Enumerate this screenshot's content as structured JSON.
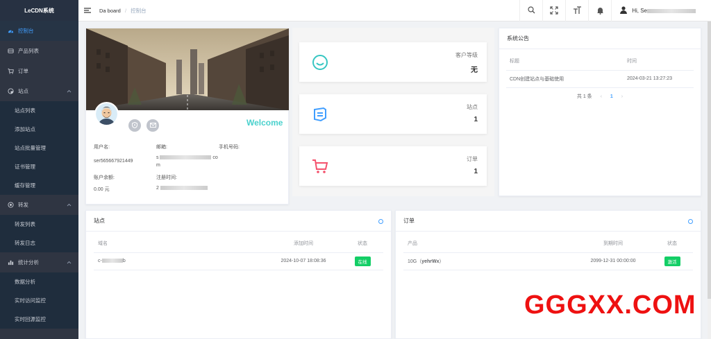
{
  "sidebar": {
    "logo": "LeCDN系统",
    "items": [
      {
        "label": "控制台",
        "icon": "dashboard-icon",
        "active": true
      },
      {
        "label": "产品列表",
        "icon": "product-icon"
      },
      {
        "label": "订单",
        "icon": "cart-icon"
      },
      {
        "label": "站点",
        "icon": "site-icon",
        "expanded": true
      },
      {
        "label": "站点列表"
      },
      {
        "label": "添加站点"
      },
      {
        "label": "站点批量管理"
      },
      {
        "label": "证书管理"
      },
      {
        "label": "缓存管理"
      },
      {
        "label": "转发",
        "icon": "forward-icon",
        "expanded": true
      },
      {
        "label": "转发列表"
      },
      {
        "label": "转发日志"
      },
      {
        "label": "统计分析",
        "icon": "stats-icon",
        "expanded": true
      },
      {
        "label": "数据分析"
      },
      {
        "label": "实时访问监控"
      },
      {
        "label": "实时回源监控"
      }
    ]
  },
  "header": {
    "breadcrumb_root": "Da    board",
    "breadcrumb_sep": "/",
    "breadcrumb_current": "控制台",
    "greeting": "Hi, Se"
  },
  "profile": {
    "welcome": "Welcome",
    "username_label": "用户名:",
    "username_value": "ser565667921449",
    "email_label": "邮箱:",
    "email_value_start": "s",
    "email_value_end": "co",
    "email_value_wrap": "m",
    "phone_label": "手机号码:",
    "balance_label": "账户余额:",
    "balance_value": "0.00 元",
    "register_label": "注册时间:",
    "register_value_start": "2"
  },
  "stats": [
    {
      "label": "客户等级",
      "value": "无",
      "icon": "smile-icon",
      "color": "#36c6c2"
    },
    {
      "label": "站点",
      "value": "1",
      "icon": "site-badge-icon",
      "color": "#409eff"
    },
    {
      "label": "订单",
      "value": "1",
      "icon": "cart-icon",
      "color": "#f4516c"
    }
  ],
  "announcements": {
    "title": "系统公告",
    "columns": [
      "标题",
      "时间"
    ],
    "rows": [
      {
        "title": "CDN创建站点与基础使用",
        "time": "2024-03-21 13:27:23"
      }
    ],
    "pager": {
      "total": "共 1 条",
      "prev": "‹",
      "page": "1",
      "next": "›"
    }
  },
  "sites_panel": {
    "title": "站点",
    "columns": [
      "域名",
      "添加时间",
      "状态"
    ],
    "rows": [
      {
        "domain_start": "c-",
        "domain_end": "b",
        "added": "2024-10-07 18:08:36",
        "status": "在线"
      }
    ]
  },
  "orders_panel": {
    "title": "订单",
    "columns": [
      "产品",
      "到期时间",
      "状态"
    ],
    "rows": [
      {
        "product_prefix": "10G（",
        "product_code": "yehrWx",
        "product_suffix": "）",
        "expires": "2099-12-31 00:00:00",
        "status": "激活"
      }
    ]
  },
  "watermark": "GGGXX.COM"
}
